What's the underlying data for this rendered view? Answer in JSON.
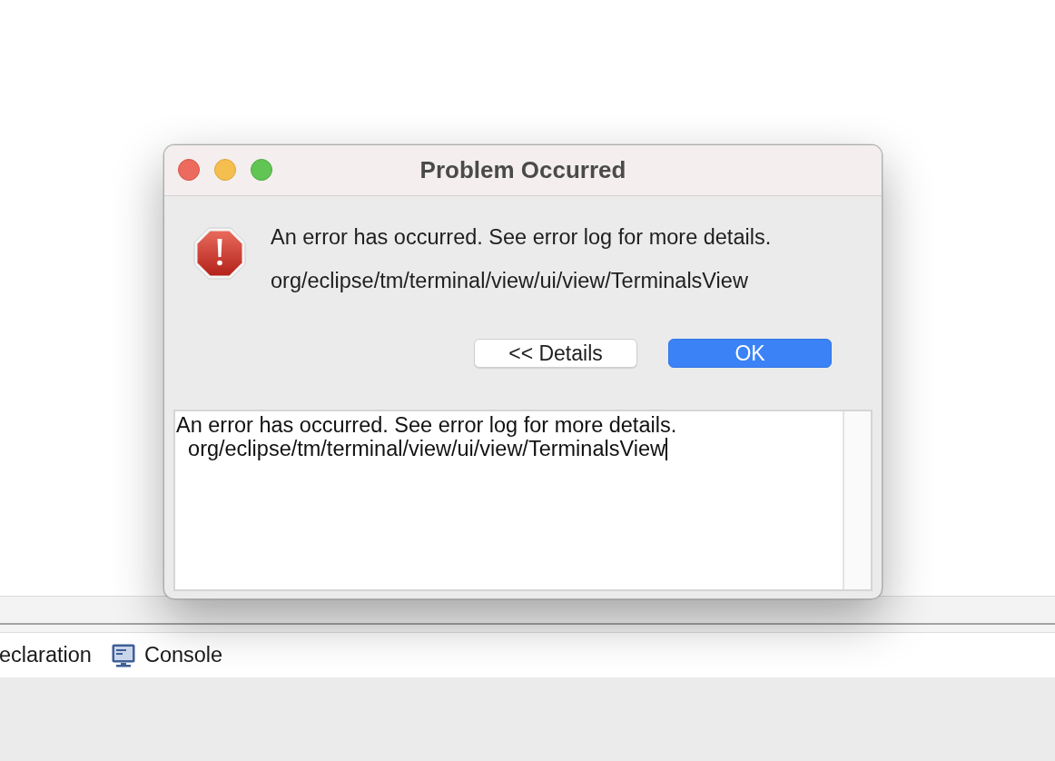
{
  "window": {
    "title": "Problem Occurred"
  },
  "message": {
    "summary": "An error has occurred. See error log for more details.",
    "detail": "org/eclipse/tm/terminal/view/ui/view/TerminalsView"
  },
  "buttons": [
    {
      "label": "<< Details",
      "kind": "push"
    },
    {
      "label": "OK",
      "kind": "default"
    }
  ],
  "details": {
    "lines": [
      "An error has occurred. See error log for more details.",
      "  org/eclipse/tm/terminal/view/ui/view/TerminalsView"
    ],
    "focused": true
  },
  "background_tabs": [
    {
      "label": "eclaration",
      "kind": "text"
    },
    {
      "label": "Console",
      "kind": "console"
    }
  ]
}
